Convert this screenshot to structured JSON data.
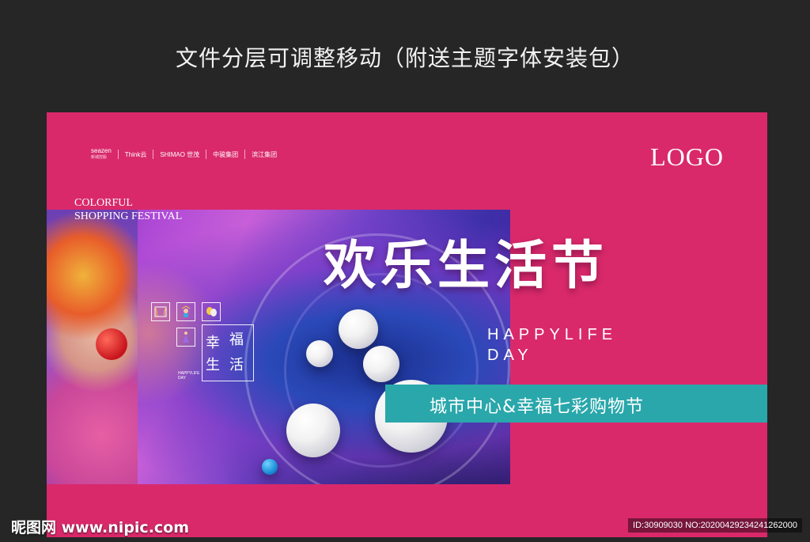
{
  "header": {
    "text": "文件分层可调整移动（附送主题字体安装包）"
  },
  "board": {
    "logo": "LOGO",
    "partners": [
      {
        "name": "seazen",
        "sub": "新城控股"
      },
      {
        "name": "Think云",
        "sub": ""
      },
      {
        "name": "SHIMAO 世茂",
        "sub": ""
      },
      {
        "name": "中骏集团",
        "sub": ""
      },
      {
        "name": "滨江集团",
        "sub": ""
      }
    ],
    "colorful_line1": "COLORFUL",
    "colorful_line2": "SHOPPING FESTIVAL",
    "fuk": {
      "c1": "幸",
      "c2": "福",
      "c3": "生",
      "c4": "活"
    },
    "tiny_line1": "HAPPYLIFE",
    "tiny_line2": "DAY",
    "title": "欢乐生活节",
    "happylife_line1": "HAPPYLIFE",
    "happylife_line2": "DAY",
    "banner": "城市中心&幸福七彩购物节",
    "colors": {
      "background": "#262626",
      "board": "#d9296b",
      "banner": "#2aa7ab"
    }
  },
  "watermark": {
    "left": "昵图网 www.nipic.com",
    "right": "ID:30909030 NO:20200429234241262000"
  }
}
